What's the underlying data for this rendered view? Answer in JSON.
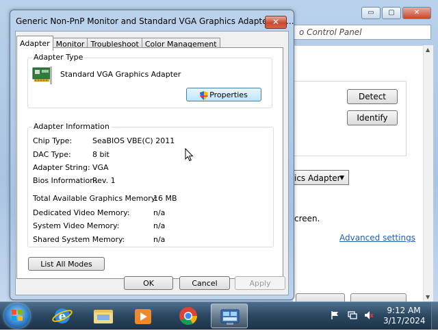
{
  "background_window": {
    "address_text": "o Control Panel",
    "detect_label": "Detect",
    "identify_label": "Identify",
    "dropdown_text": "ics Adapter",
    "screen_text": "creen.",
    "advanced_link": "Advanced settings",
    "caption_min": "▭",
    "caption_max": "▢",
    "caption_close": "✕"
  },
  "dialog": {
    "title": "Generic Non-PnP Monitor and Standard VGA Graphics Adapter Pro...",
    "close_label": "✕",
    "tabs": [
      {
        "label": "Adapter",
        "active": true
      },
      {
        "label": "Monitor",
        "active": false
      },
      {
        "label": "Troubleshoot",
        "active": false
      },
      {
        "label": "Color Management",
        "active": false
      }
    ],
    "adapter_type": {
      "group_label": "Adapter Type",
      "name": "Standard VGA Graphics Adapter",
      "properties_label": "Properties"
    },
    "adapter_info": {
      "group_label": "Adapter Information",
      "rows": [
        {
          "label": "Chip Type:",
          "value": "SeaBIOS VBE(C) 2011"
        },
        {
          "label": "DAC Type:",
          "value": "8 bit"
        },
        {
          "label": "Adapter String:",
          "value": "VGA"
        },
        {
          "label": "Bios Information:",
          "value": "Rev. 1"
        }
      ],
      "memory_rows": [
        {
          "label": "Total Available Graphics Memory:",
          "value": "16 MB"
        },
        {
          "label": "Dedicated Video Memory:",
          "value": "n/a"
        },
        {
          "label": "System Video Memory:",
          "value": "n/a"
        },
        {
          "label": "Shared System Memory:",
          "value": "n/a"
        }
      ]
    },
    "list_all_modes_label": "List All Modes",
    "ok_label": "OK",
    "cancel_label": "Cancel",
    "apply_label": "Apply"
  },
  "taskbar": {
    "time": "9:12 AM",
    "date": "3/17/2024",
    "apps": [
      "internet-explorer",
      "file-explorer",
      "media-player",
      "chrome",
      "display-control-panel"
    ]
  },
  "colors": {
    "link": "#1f5fb0",
    "taskbar": "#2a4660",
    "dialog_frame": "#a6c2e3"
  }
}
